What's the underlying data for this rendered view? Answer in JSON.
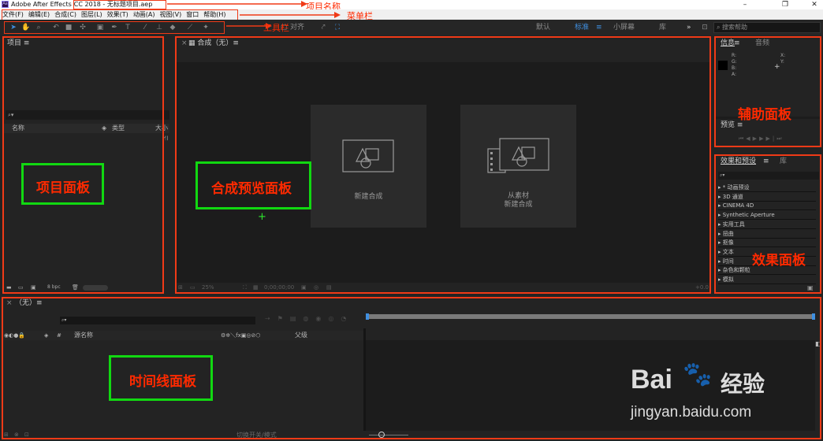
{
  "window": {
    "title_app": "Adobe After Effects",
    "title_file": "CC 2018 - 无标题项目.aep",
    "logo": "Ae"
  },
  "menu": [
    "文件(F)",
    "编辑(E)",
    "合成(C)",
    "图层(L)",
    "效果(T)",
    "动画(A)",
    "视图(V)",
    "窗口",
    "帮助(H)"
  ],
  "toolbar": {
    "align_label": "对齐",
    "workspaces": [
      "默认",
      "标准",
      "小屏幕",
      "库"
    ],
    "search_placeholder": "搜索帮助"
  },
  "project": {
    "tab": "项目 ≡",
    "search_icon": "⌕▾",
    "columns": [
      "名称",
      "类型",
      "大小"
    ],
    "bpc": "8 bpc"
  },
  "composition": {
    "tab_close": "×",
    "tab_label": "合成（无）≡",
    "cards": [
      {
        "label": "新建合成"
      },
      {
        "label_line1": "从素材",
        "label_line2": "新建合成"
      }
    ],
    "zoom": "25%",
    "timecode": "0;00;00;00",
    "offset": "+0.0"
  },
  "info": {
    "tabs": [
      "信息",
      "音频"
    ],
    "rgba": "R:\nG:\nB:\nA:",
    "xy": "X:\nY:",
    "preview": "预览 ≡"
  },
  "effects": {
    "tabs": [
      "效果和预设",
      "库"
    ],
    "search": "⌕▾",
    "items": [
      "▸ * 动画预设",
      "▸ 3D 通道",
      "▸ CINEMA 4D",
      "▸ Synthetic Aperture",
      "▸ 实用工具",
      "▸ 扭曲",
      "▸ 抠像",
      "▸ 文本",
      "▸ 时间",
      "▸ 杂色和颗粒",
      "▸ 模拟"
    ]
  },
  "timeline": {
    "tab": "（无）≡",
    "source_name": "源名称",
    "parent": "父级",
    "switch_mode": "切换开关/模式"
  },
  "annotations": {
    "project_name": "项目名称",
    "menubar": "菜单栏",
    "toolbar": "工具栏",
    "project_panel": "项目面板",
    "comp_panel": "合成预览面板",
    "aux_panel": "辅助面板",
    "effects_panel": "效果面板",
    "timeline_panel": "时间线面板"
  },
  "watermark": {
    "brand": "Bai",
    "brand2": "经验",
    "url": "jingyan.baidu.com"
  },
  "colors": {
    "accent": "#3f8fe0",
    "annotation_red": "#f03a17",
    "annotation_green": "#11d811"
  }
}
